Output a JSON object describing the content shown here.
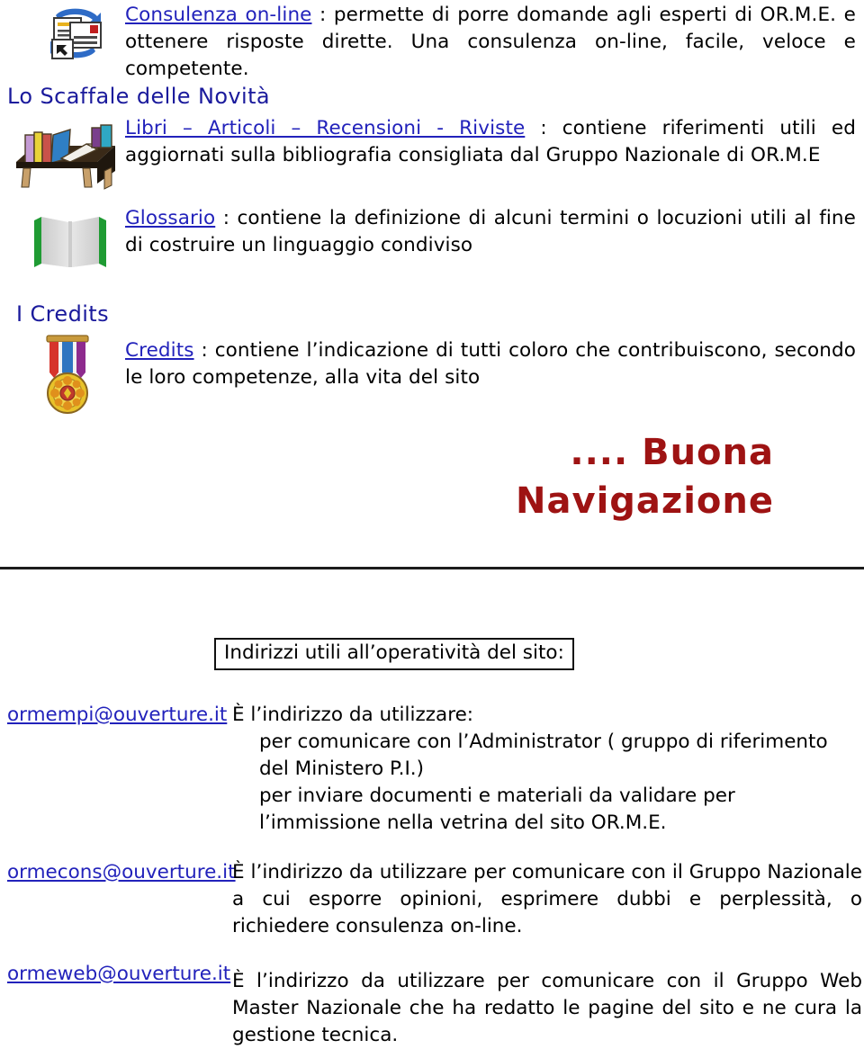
{
  "document": {
    "language": "it",
    "sections": {
      "consulenza": {
        "icon": "document-exchange-icon",
        "link_label": "Consulenza on-line",
        "text": " : permette di porre domande agli esperti di OR.M.E. e ottenere risposte dirette. Una consulenza on-line, facile, veloce e competente."
      },
      "scaffale": {
        "heading": "Lo Scaffale delle Novità",
        "icon": "bookshelf-icon",
        "link_label": "Libri – Articoli – Recensioni - Riviste",
        "text": " : contiene riferimenti utili ed aggiornati sulla bibliografia consigliata dal Gruppo Nazionale di OR.M.E"
      },
      "glossario": {
        "icon": "open-book-icon",
        "link_label": "Glossario",
        "text": " : contiene la definizione di alcuni termini o locuzioni utili al fine di costruire un linguaggio condiviso"
      },
      "credits": {
        "heading": "I Credits",
        "icon": "medal-icon",
        "link_label": "Credits",
        "text": " : contiene l’indicazione di tutti coloro che contribuiscono, secondo le loro competenze, alla vita del sito"
      },
      "closing": {
        "line1": ".... Buona",
        "line2": "Navigazione",
        "color": "#9e1313"
      },
      "addresses_title": "Indirizzi utili all’operatività del sito:",
      "addresses": [
        {
          "email": "ormempi@ouverture.it",
          "intro": "È l’indirizzo da utilizzare:",
          "bullets": [
            "per comunicare con l’Administrator ( gruppo di riferimento del Ministero P.I.)",
            "per inviare documenti e materiali da validare per l’immissione nella vetrina del sito OR.M.E."
          ]
        },
        {
          "email": "ormecons@ouverture.it",
          "intro": "È l’indirizzo da utilizzare per comunicare con il Gruppo Nazionale a cui esporre opinioni, esprimere dubbi e perplessità, o  richiedere consulenza on-line.",
          "bullets": []
        },
        {
          "email": "ormeweb@ouverture.it",
          "intro": "È l’indirizzo da utilizzare per comunicare con il Gruppo Web Master Nazionale che ha redatto le pagine del sito e ne cura la gestione tecnica.",
          "bullets": []
        }
      ]
    },
    "colors": {
      "link": "#2222bb",
      "heading": "#1a1a9c",
      "closing": "#9e1313",
      "rule": "#1c1c1c"
    }
  }
}
